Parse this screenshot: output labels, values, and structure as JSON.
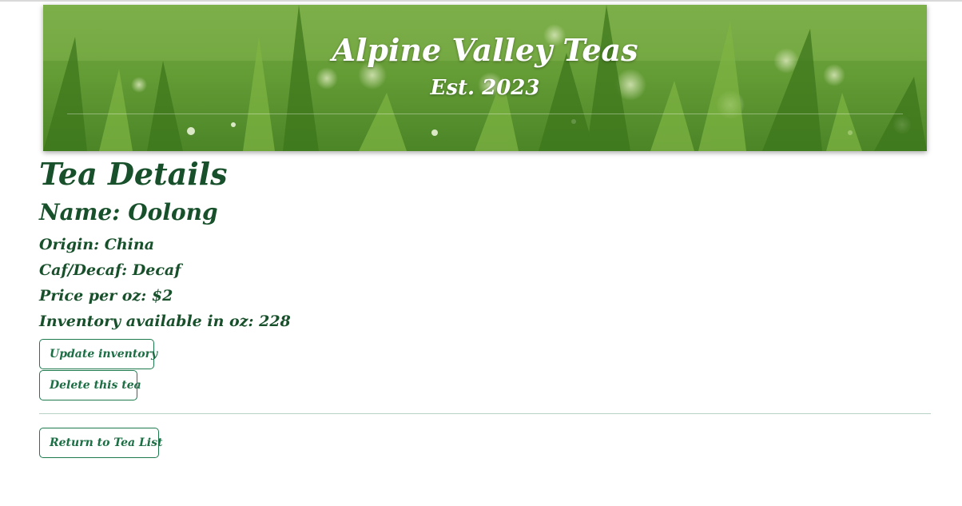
{
  "header": {
    "title": "Alpine Valley Teas",
    "subtitle": "Est. 2023"
  },
  "main": {
    "heading": "Tea Details",
    "name": "Name: Oolong",
    "origin": "Origin: China",
    "caf_decaf": "Caf/Decaf: Decaf",
    "price": "Price per oz: $2",
    "inventory": "Inventory available in oz: 228"
  },
  "actions": {
    "update_label": "Update inventory",
    "delete_label": "Delete this tea",
    "return_label": "Return to Tea List"
  },
  "colors": {
    "text": "#17502b",
    "button_border": "#1c7a4d",
    "header_title": "#ffffff",
    "divider": "#b7d3c5"
  }
}
